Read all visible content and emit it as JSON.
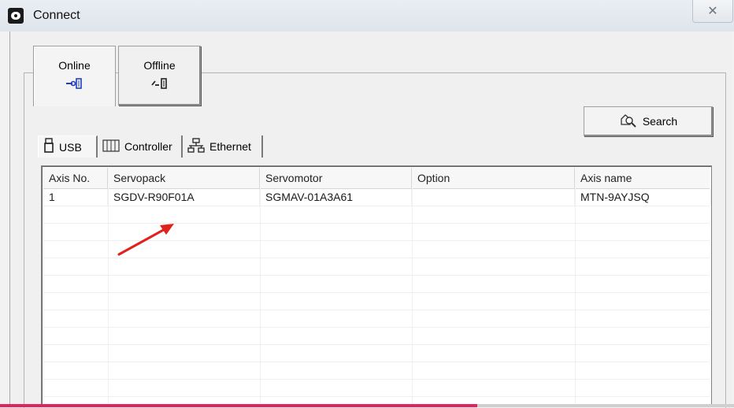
{
  "window": {
    "title": "Connect",
    "close_glyph": "✕"
  },
  "mode_tabs": [
    {
      "label": "Online",
      "icon": "online-connector-icon"
    },
    {
      "label": "Offline",
      "icon": "offline-connector-icon"
    }
  ],
  "search_button": {
    "label": "Search",
    "icon": "search-icon"
  },
  "connection_tabs": [
    {
      "label": "USB",
      "icon": "usb-icon",
      "selected": true
    },
    {
      "label": "Controller",
      "icon": "controller-icon",
      "selected": false
    },
    {
      "label": "Ethernet",
      "icon": "network-icon",
      "selected": false
    }
  ],
  "table": {
    "columns": [
      "Axis No.",
      "Servopack",
      "Servomotor",
      "Option",
      "Axis name"
    ],
    "rows": [
      [
        "1",
        "SGDV-R90F01A",
        "SGMAV-01A3A61",
        "",
        "MTN-9AYJSQ"
      ]
    ]
  },
  "video_progress": {
    "fraction": 0.65
  },
  "colors": {
    "annotation_arrow": "#e0221c",
    "progress": "#e0245e",
    "online_icon": "#1f3fbf"
  }
}
